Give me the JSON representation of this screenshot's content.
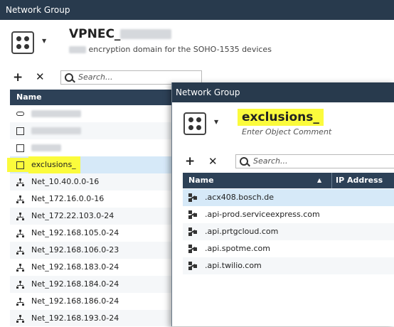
{
  "window1": {
    "title": "Network Group",
    "object_name": "VPNEC_",
    "comment_suffix": "encryption domain for the SOHO-1535 devices",
    "search_placeholder": "Search...",
    "column_name": "Name",
    "rows": [
      {
        "label": "",
        "blurred": true,
        "icon": "host-icon"
      },
      {
        "label": "",
        "blurred": true,
        "icon": "group-icon"
      },
      {
        "label": "",
        "blurred": true,
        "icon": "group-icon"
      },
      {
        "label": "exclusions_",
        "blurred": false,
        "icon": "group-icon",
        "selected": true
      },
      {
        "label": "Net_10.40.0.0-16",
        "icon": "network-icon"
      },
      {
        "label": "Net_172.16.0.0-16",
        "icon": "network-icon"
      },
      {
        "label": "Net_172.22.103.0-24",
        "icon": "network-icon"
      },
      {
        "label": "Net_192.168.105.0-24",
        "icon": "network-icon"
      },
      {
        "label": "Net_192.168.106.0-23",
        "icon": "network-icon"
      },
      {
        "label": "Net_192.168.183.0-24",
        "icon": "network-icon"
      },
      {
        "label": "Net_192.168.184.0-24",
        "icon": "network-icon"
      },
      {
        "label": "Net_192.168.186.0-24",
        "icon": "network-icon"
      },
      {
        "label": "Net_192.168.193.0-24",
        "icon": "network-icon"
      }
    ]
  },
  "window2": {
    "title": "Network Group",
    "object_name": "exclusions_",
    "comment_placeholder": "Enter Object Comment",
    "search_placeholder": "Search...",
    "column_name": "Name",
    "column_sort_indicator": "▲",
    "column_ip": "IP Address",
    "rows": [
      {
        "label": ".acx408.bosch.de",
        "icon": "domain-icon"
      },
      {
        "label": ".api-prod.serviceexpress.com",
        "icon": "domain-icon"
      },
      {
        "label": ".api.prtgcloud.com",
        "icon": "domain-icon"
      },
      {
        "label": ".api.spotme.com",
        "icon": "domain-icon"
      },
      {
        "label": ".api.twilio.com",
        "icon": "domain-icon"
      }
    ]
  },
  "colors": {
    "titlebar": "#283a4d",
    "column_header": "#2d4157",
    "selection": "#d6e9f8",
    "highlight": "#fbfb3c"
  }
}
